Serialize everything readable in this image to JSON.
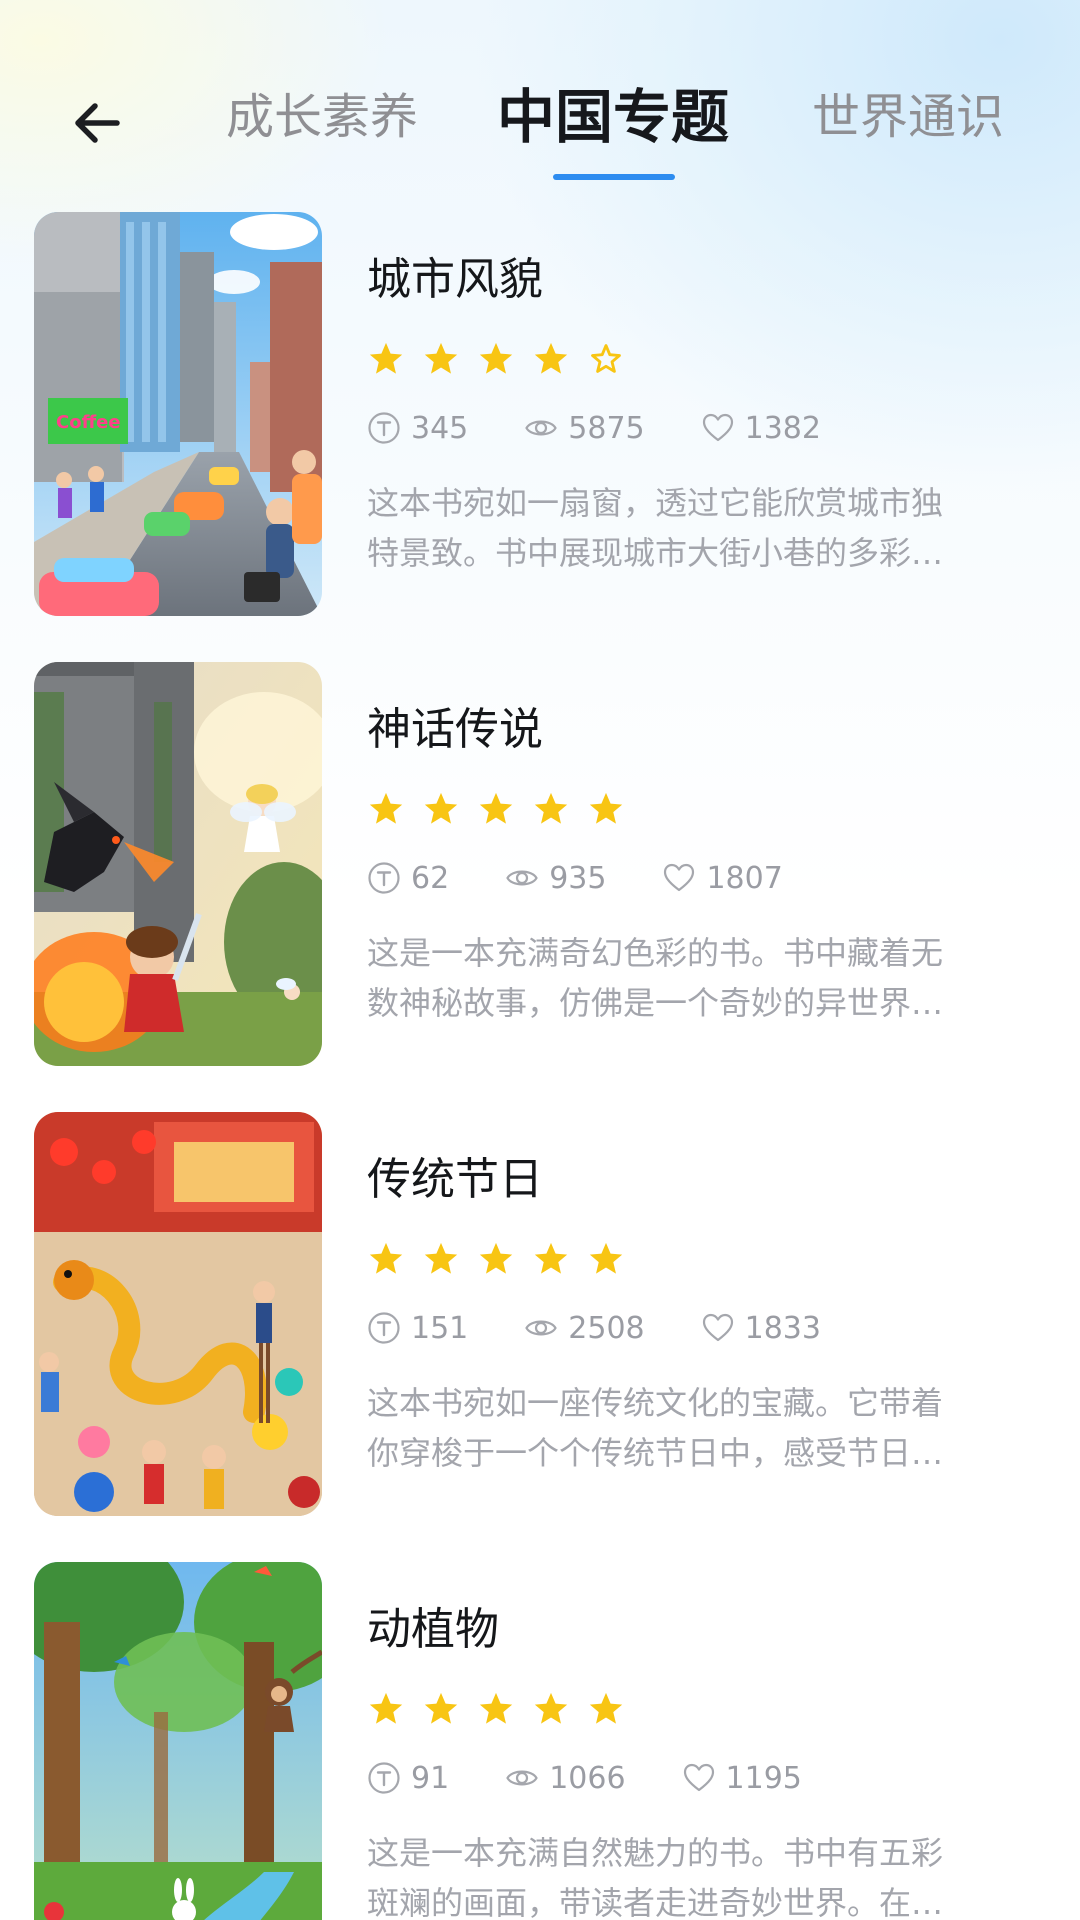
{
  "header": {
    "tabs": [
      "成长素养",
      "中国专题",
      "世界通识"
    ],
    "active_tab_index": 1,
    "accent_color": "#2d8cf0"
  },
  "books": [
    {
      "title": "城市风貌",
      "rating": 4,
      "rating_max": 5,
      "words": "345",
      "views": "5875",
      "likes": "1382",
      "desc_line1": "这本书宛如一扇窗，透过它能欣赏城市独",
      "desc_line2": "特景致。书中展现城市大街小巷的多彩…",
      "cover_sign": "Coffee"
    },
    {
      "title": "神话传说",
      "rating": 5,
      "rating_max": 5,
      "words": "62",
      "views": "935",
      "likes": "1807",
      "desc_line1": "这是一本充满奇幻色彩的书。书中藏着无",
      "desc_line2": "数神秘故事，仿佛是一个奇妙的异世界…"
    },
    {
      "title": "传统节日",
      "rating": 5,
      "rating_max": 5,
      "words": "151",
      "views": "2508",
      "likes": "1833",
      "desc_line1": "这本书宛如一座传统文化的宝藏。它带着",
      "desc_line2": "你穿梭于一个个传统节日中，感受节日…"
    },
    {
      "title": "动植物",
      "rating": 5,
      "rating_max": 5,
      "words": "91",
      "views": "1066",
      "likes": "1195",
      "desc_line1": "这是一本充满自然魅力的书。书中有五彩",
      "desc_line2": "斑斓的画面，带读者走进奇妙世界。在…"
    }
  ],
  "colors": {
    "star": "#f8c513",
    "title": "#15171a",
    "meta": "#9a9ca3",
    "desc": "#a3a5ac"
  }
}
